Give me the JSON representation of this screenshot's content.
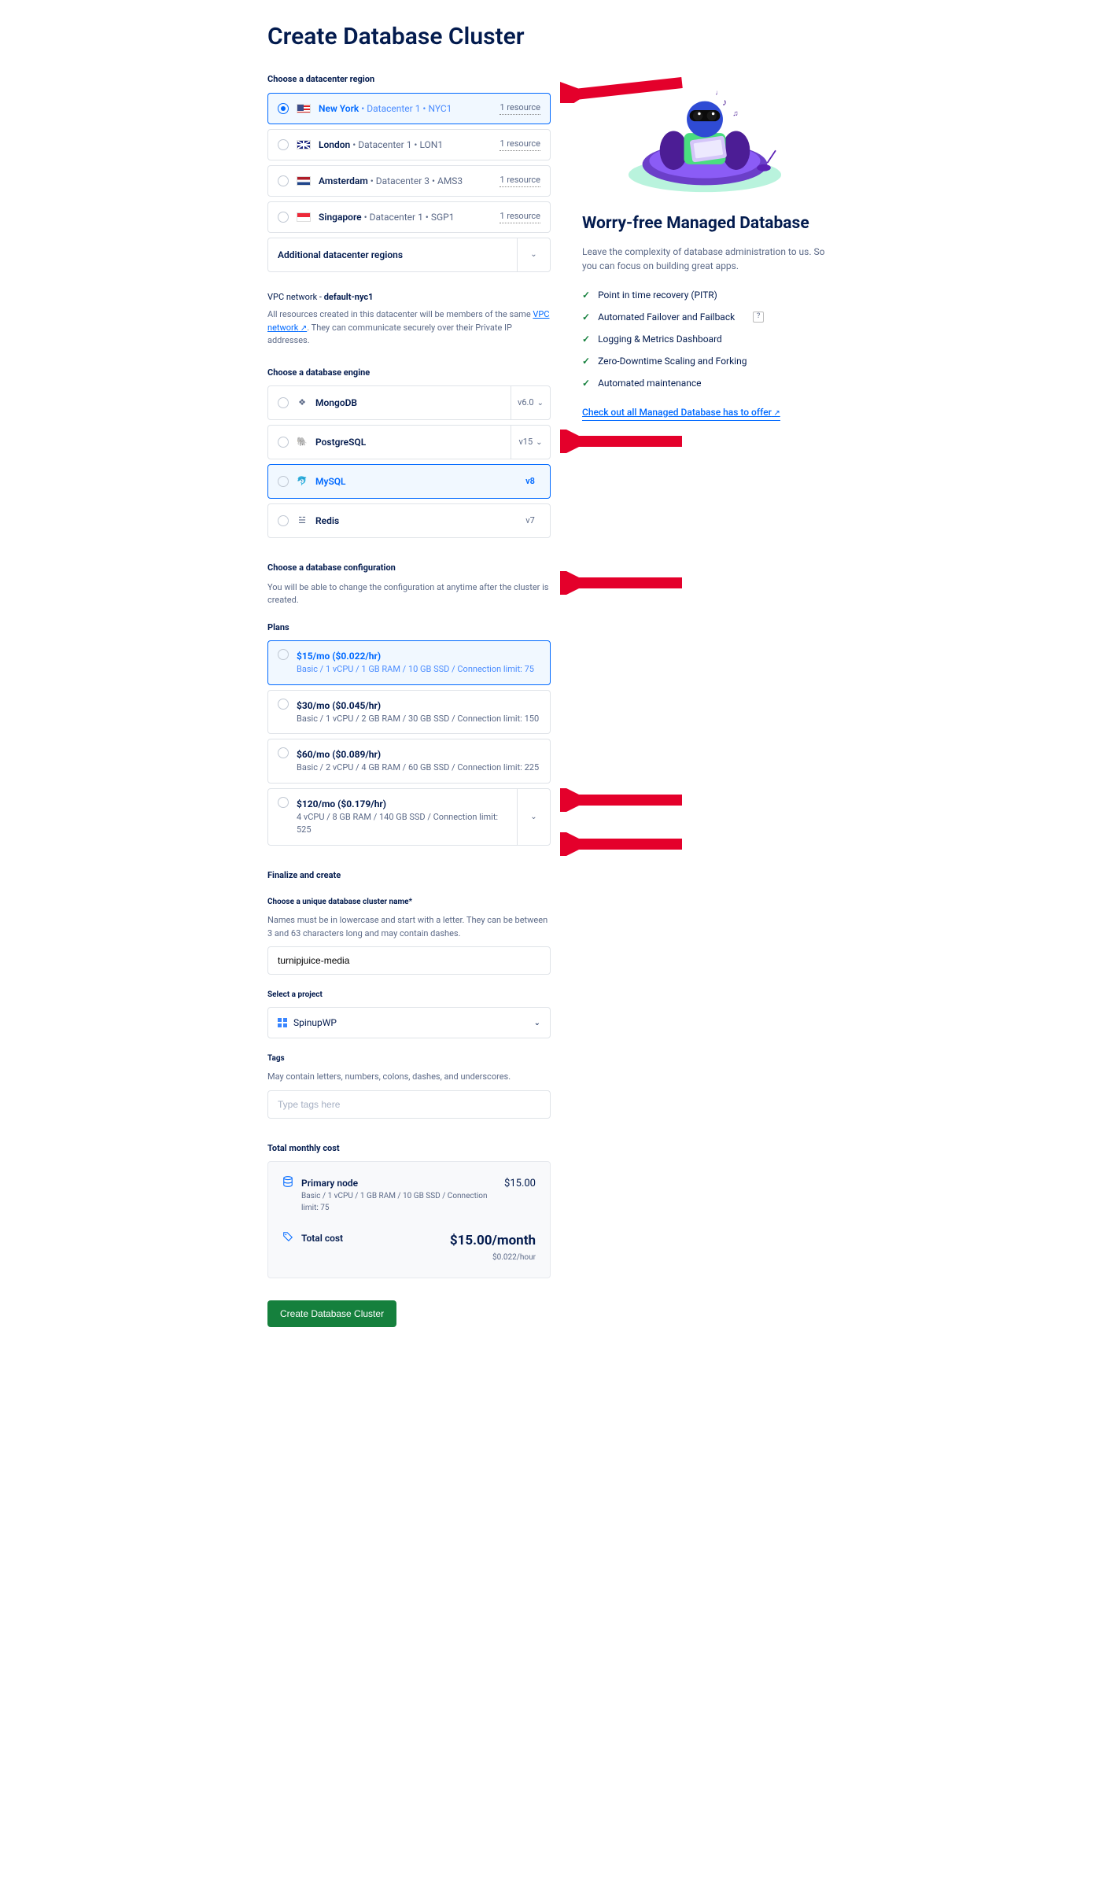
{
  "page_title": "Create Database Cluster",
  "datacenter": {
    "heading": "Choose a datacenter region",
    "regions": [
      {
        "city": "New York",
        "detail": " • Datacenter 1 • NYC1",
        "badge": "1 resource",
        "flag": "us",
        "selected": true
      },
      {
        "city": "London",
        "detail": " • Datacenter 1 • LON1",
        "badge": "1 resource",
        "flag": "uk",
        "selected": false
      },
      {
        "city": "Amsterdam",
        "detail": " • Datacenter 3 • AMS3",
        "badge": "1 resource",
        "flag": "nl",
        "selected": false
      },
      {
        "city": "Singapore",
        "detail": " • Datacenter 1 • SGP1",
        "badge": "1 resource",
        "flag": "sg",
        "selected": false
      }
    ],
    "additional_label": "Additional datacenter regions"
  },
  "vpc": {
    "title_prefix": "VPC network - ",
    "name": "default-nyc1",
    "text_pre": "All resources created in this datacenter will be members of the same ",
    "link": "VPC network",
    "text_post": ". They can communicate securely over their Private IP addresses."
  },
  "engine": {
    "heading": "Choose a database engine",
    "items": [
      {
        "name": "MongoDB",
        "ver": "v6.0",
        "dd": true,
        "selected": false,
        "icon": "leaf"
      },
      {
        "name": "PostgreSQL",
        "ver": "v15",
        "dd": true,
        "selected": false,
        "icon": "elephant"
      },
      {
        "name": "MySQL",
        "ver": "v8",
        "dd": false,
        "selected": true,
        "icon": "dolphin"
      },
      {
        "name": "Redis",
        "ver": "v7",
        "dd": false,
        "selected": false,
        "icon": "stack"
      }
    ]
  },
  "config": {
    "heading": "Choose a database configuration",
    "sub": "You will be able to change the configuration at anytime after the cluster is created.",
    "plans_heading": "Plans",
    "plans": [
      {
        "price": "$15/mo ($0.022/hr)",
        "spec": "Basic / 1 vCPU / 1 GB RAM / 10 GB SSD / Connection limit: 75",
        "selected": true
      },
      {
        "price": "$30/mo ($0.045/hr)",
        "spec": "Basic / 1 vCPU / 2 GB RAM / 30 GB SSD / Connection limit: 150",
        "selected": false
      },
      {
        "price": "$60/mo ($0.089/hr)",
        "spec": "Basic / 2 vCPU / 4 GB RAM / 60 GB SSD / Connection limit: 225",
        "selected": false
      }
    ],
    "plan_dd": {
      "price": "$120/mo ($0.179/hr)",
      "spec": "4 vCPU / 8 GB RAM / 140 GB SSD / Connection limit: 525"
    }
  },
  "finalize": {
    "heading": "Finalize and create",
    "name_label": "Choose a unique database cluster name*",
    "name_help": "Names must be in lowercase and start with a letter. They can be between 3 and 63 characters long and may contain dashes.",
    "name_value": "turnipjuice-media",
    "project_label": "Select a project",
    "project_value": "SpinupWP",
    "tags_label": "Tags",
    "tags_help": "May contain letters, numbers, colons, dashes, and underscores.",
    "tags_placeholder": "Type tags here"
  },
  "cost": {
    "heading": "Total monthly cost",
    "primary_label": "Primary node",
    "primary_spec": "Basic / 1 vCPU / 1 GB RAM / 10 GB SSD / Connection limit: 75",
    "primary_amount": "$15.00",
    "total_label": "Total cost",
    "total_month": "$15.00/month",
    "total_hour": "$0.022/hour"
  },
  "create_button": "Create Database Cluster",
  "promo": {
    "title": "Worry-free Managed Database",
    "lead": "Leave the complexity of database administration to us. So you can focus on building great apps.",
    "features": [
      "Point in time recovery (PITR)",
      "Automated Failover and Failback",
      "Logging & Metrics Dashboard",
      "Zero-Downtime Scaling and Forking",
      "Automated maintenance"
    ],
    "link": "Check out all Managed Database has to offer"
  }
}
